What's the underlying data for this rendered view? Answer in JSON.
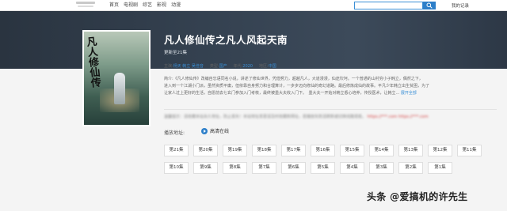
{
  "nav": {
    "items": [
      "首页",
      "电视剧",
      "综艺",
      "影视",
      "动漫"
    ],
    "login": "我的记录"
  },
  "show": {
    "title": "凡人修仙传之凡人风起天南",
    "subtitle": "更新至21集",
    "poster_text": "凡人修仙传",
    "info": [
      {
        "key": "主演:",
        "value": "杨天 韩立 吴佳音"
      },
      {
        "key": "类型:",
        "value": "国产"
      },
      {
        "key": "年代:",
        "value": "2020"
      },
      {
        "key": "地区:",
        "value": "中国"
      }
    ],
    "description_lines": [
      "简介:《凡人修仙传》改编自忘语同名小说，讲述了修仙世界，凭借努力，超越凡人，大道漫漫，仙途坎坷。一个普通的山村穷小子韩立，偶然之下，",
      "进入到一个江湖小门派，虽然资质平庸，但依靠自身努力和合理算计，一步步迈向修仙的奇幻道路。最后修炼成仙的故事。平凡少年韩立出生贫困，为了",
      "让家人过上更好的生活，自愿前去七玄门参加入门考核，最终被墨大夫收入门下。　墨大夫一开始对韩立悉心培养，传授医术，让韩立..."
    ],
    "more_label": "展开全部"
  },
  "notice": {
    "text": "温馨提示：请收藏本站永久地址，防止丢失！本站地址变更请及时收藏新网址，若播放失败请刷新或切换线路观看。",
    "highlight_1": "https://***.com",
    "highlight_2": "https://***.com"
  },
  "source": {
    "label": "播放地址:",
    "name": "高清在线"
  },
  "episodes": [
    "第21集",
    "第20集",
    "第19集",
    "第18集",
    "第17集",
    "第16集",
    "第15集",
    "第14集",
    "第13集",
    "第12集",
    "第11集",
    "第10集",
    "第9集",
    "第8集",
    "第7集",
    "第6集",
    "第5集",
    "第4集",
    "第3集",
    "第2集",
    "第1集"
  ],
  "watermark": "头条 @爱搞机的许先生"
}
